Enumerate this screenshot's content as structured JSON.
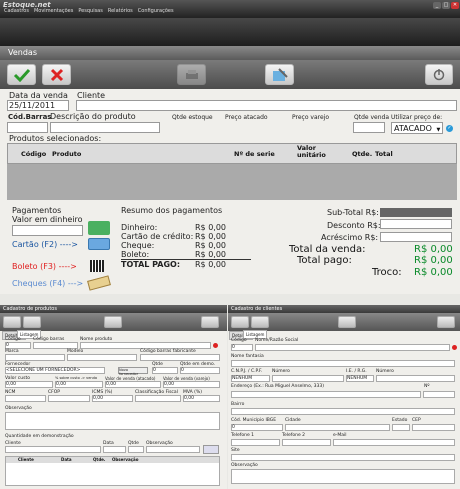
{
  "app": {
    "title": "Estoque.net"
  },
  "menu": [
    "Cadastros",
    "Movimentações",
    "Pesquisas",
    "Relatórios",
    "Configurações"
  ],
  "vendas": {
    "header": "Vendas",
    "data_venda_label": "Data da venda",
    "data_venda_value": "25/11/2011",
    "cliente_label": "Cliente",
    "cod_barras_label": "Cód.Barras",
    "descricao_label": "Descrição do produto",
    "qtde_estoque_label": "Qtde estoque",
    "preco_atacado_label": "Preço atacado",
    "preco_varejo_label": "Preço varejo",
    "qtde_venda_label": "Qtde venda",
    "utilizar_preco_label": "Utilizar preço de:",
    "utilizar_preco_value": "ATACADO",
    "produtos_selecionados": "Produtos selecionados:",
    "grid_headers": {
      "codigo": "Código",
      "produto": "Produto",
      "serie": "Nº de serie",
      "valor_unitario": "Valor unitário",
      "qtde": "Qtde.",
      "total": "Total"
    },
    "pagamentos": "Pagamentos",
    "valor_dinheiro": "Valor em dinheiro",
    "cartao": "Cartão (F2) ---->",
    "boleto": "Boleto (F3) ---->",
    "cheques": "Cheques (F4) --->",
    "resumo_title": "Resumo dos pagamentos",
    "resumo": [
      {
        "label": "Dinheiro:",
        "value": "R$ 0,00"
      },
      {
        "label": "Cartão de crédito:",
        "value": "R$ 0,00"
      },
      {
        "label": "Cheque:",
        "value": "R$ 0,00"
      },
      {
        "label": "Boleto:",
        "value": "R$ 0,00"
      }
    ],
    "total_pago_label": "TOTAL PAGO:",
    "total_pago_value": "R$ 0,00",
    "subtotal_label": "Sub-Total R$:",
    "desconto_label": "Desconto R$:",
    "acrescimo_label": "Acréscimo R$:",
    "total_venda_label": "Total da venda:",
    "total_venda_value": "R$ 0,00",
    "total_pago2_label": "Total pago:",
    "total_pago2_value": "R$ 0,00",
    "troco_label": "Troco:",
    "troco_value": "R$ 0,00"
  },
  "produtos": {
    "header": "Cadastro de produtos",
    "tabs": [
      "Detalhes",
      "Listagem"
    ],
    "codigo": "Código",
    "codigo_barras": "Código barras",
    "nome_produto": "Nome produto",
    "codigo_value": "0",
    "marca": "Marca",
    "modelo": "Modelo",
    "codigo_fabricante": "Código barras fabricante",
    "fornecedor": "Fornecedor",
    "fornecedor_value": "<SELECIONE UM FORNECEDOR>",
    "novo_fornecedor": "Novo fornecedor",
    "qtde": "Qtde",
    "qtde_demo": "Qtde em demo.",
    "qtde_value": "0",
    "qtde_demo_value": "0",
    "valor_custo": "Valor custo",
    "pct_custo": "% sobre custo -> venda",
    "valor_atacado": "Valor de venda (atacado)",
    "valor_varejo": "Valor de venda (varejo)",
    "zero": "0,00",
    "ncm": "NCM",
    "cfop": "CFOP",
    "icms": "ICMS (%)",
    "classificacao": "Classificação Fiscal",
    "mva": "MVA (%)",
    "observacao": "Observação",
    "qtde_demo_section": "Quantidade em demonstração",
    "cliente": "Cliente",
    "data": "Data",
    "qtde2": "Qtde",
    "observacao2": "Observação",
    "table_headers": [
      "Cliente",
      "Data",
      "Qtde.",
      "Observação"
    ]
  },
  "clientes": {
    "header": "Cadastro de clientes",
    "tabs": [
      "Detalhes",
      "Listagem"
    ],
    "codigo": "Código",
    "nome_razao": "Nome/Razão Social",
    "codigo_value": "0",
    "nome_fantasia": "Nome fantasia",
    "cnpj": "C.N.P.J. / C.P.F.",
    "numero": "Número",
    "ie_rg": "I.E. / R.G.",
    "numero2": "Número",
    "nenhum": "NENHUM",
    "endereco": "Endereço (Ex.: Rua Miguel Anselmo, 333)",
    "n": "Nº",
    "bairro": "Bairro",
    "cod_municipio": "Cód. Município IBGE",
    "cidade": "Cidade",
    "estado": "Estado",
    "cep": "CEP",
    "cod_value": "0",
    "telefone1": "Telefone 1",
    "telefone2": "Telefone 2",
    "email": "e-Mail",
    "site": "Site",
    "observacao": "Observação"
  }
}
